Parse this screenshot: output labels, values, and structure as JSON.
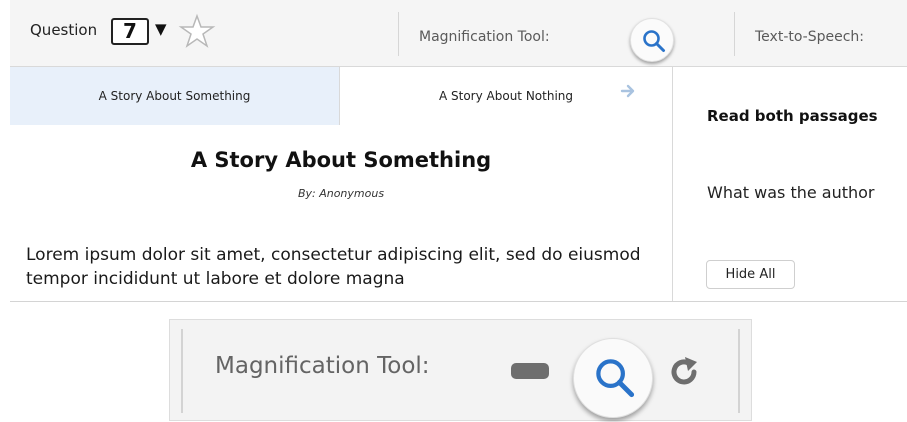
{
  "toolbar": {
    "question_label": "Question",
    "question_number": "7",
    "dropdown_glyph": "▼",
    "magnification_label": "Magnification Tool:",
    "tts_label": "Text-to-Speech:"
  },
  "tabs": [
    {
      "label": "A Story About Something",
      "active": true
    },
    {
      "label": "A Story About Nothing",
      "active": false
    }
  ],
  "passage": {
    "title": "A Story About Something",
    "author": "By: Anonymous",
    "body": "Lorem ipsum dolor sit amet, consectetur adipiscing elit, sed do eiusmod tempor incididunt ut labore et dolore magna"
  },
  "question_panel": {
    "instruction": "Read both passages",
    "question": "What was the author",
    "hide_all_label": "Hide All"
  },
  "inset": {
    "magnification_label": "Magnification Tool:"
  },
  "colors": {
    "accent": "#2a73c9",
    "active_tab_bg": "#e8f0fa",
    "toolbar_bg": "#f5f5f5",
    "muted_icon": "#6e6e6e"
  },
  "icons": [
    "star-outline-icon",
    "dropdown-arrow-icon",
    "magnifier-icon",
    "right-arrow-icon",
    "minus-icon",
    "refresh-icon"
  ]
}
